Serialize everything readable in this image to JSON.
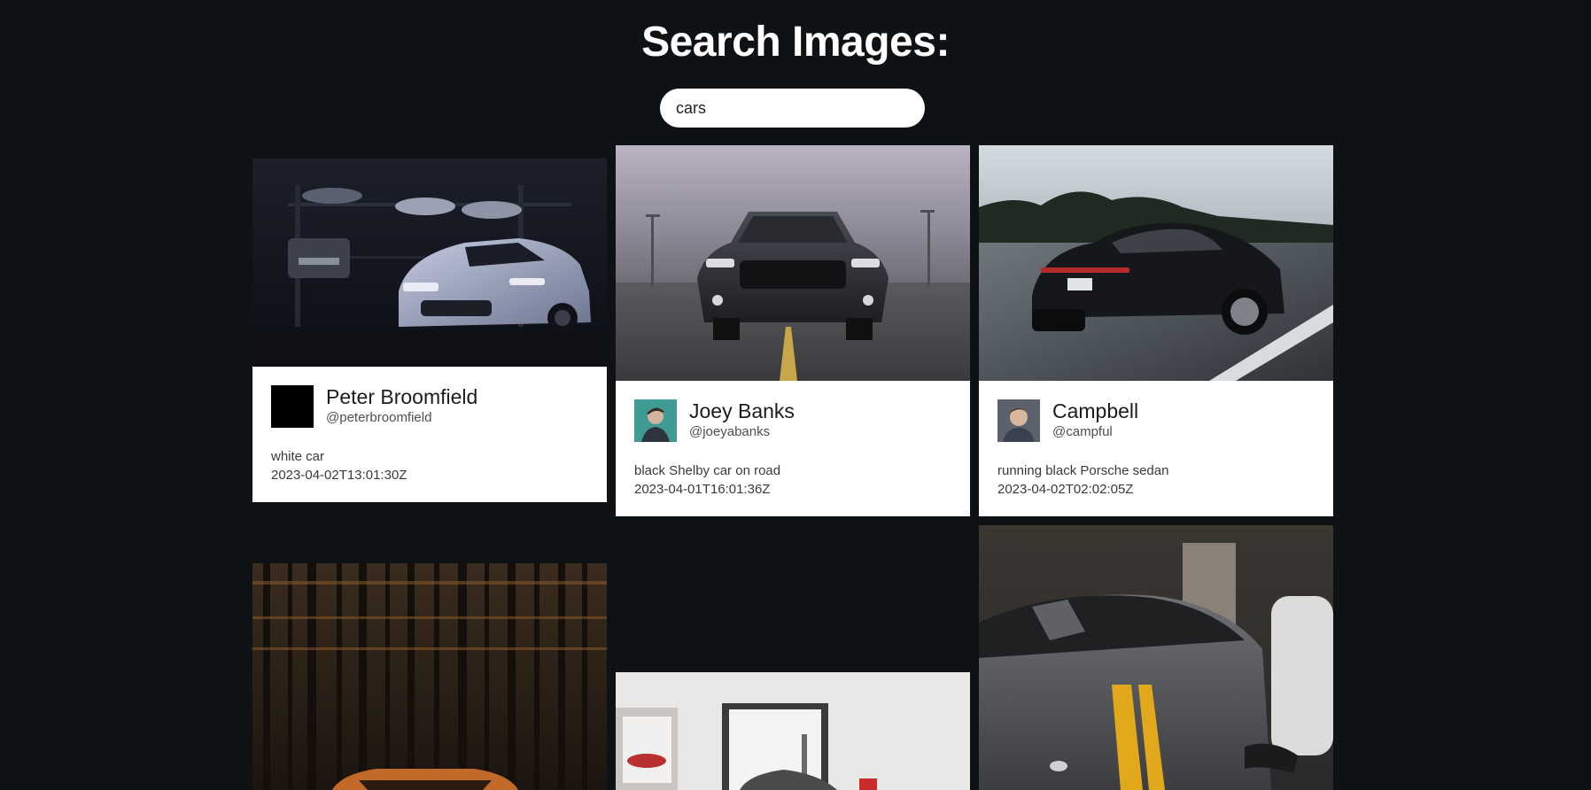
{
  "header": {
    "title": "Search Images:"
  },
  "search": {
    "value": "cars",
    "placeholder": ""
  },
  "results": [
    {
      "image_alt": "white car",
      "user_name": "Peter Broomfield",
      "user_handle": "@peterbroomfield",
      "description": "white car",
      "date": "2023-04-02T13:01:30Z"
    },
    {
      "image_alt": "black Shelby car on road",
      "user_name": "Joey Banks",
      "user_handle": "@joeyabanks",
      "description": "black Shelby car on road",
      "date": "2023-04-01T16:01:36Z"
    },
    {
      "image_alt": "running black Porsche sedan",
      "user_name": "Campbell",
      "user_handle": "@campful",
      "description": "running black Porsche sedan",
      "date": "2023-04-02T02:02:05Z"
    },
    {
      "image_alt": "orange car in forest"
    },
    {
      "image_alt": "car in white garage"
    },
    {
      "image_alt": "grey car with yellow stripe"
    }
  ],
  "colors": {
    "page_background": "#0f1215",
    "card_background": "#ffffff",
    "search_background": "#ffffff"
  }
}
